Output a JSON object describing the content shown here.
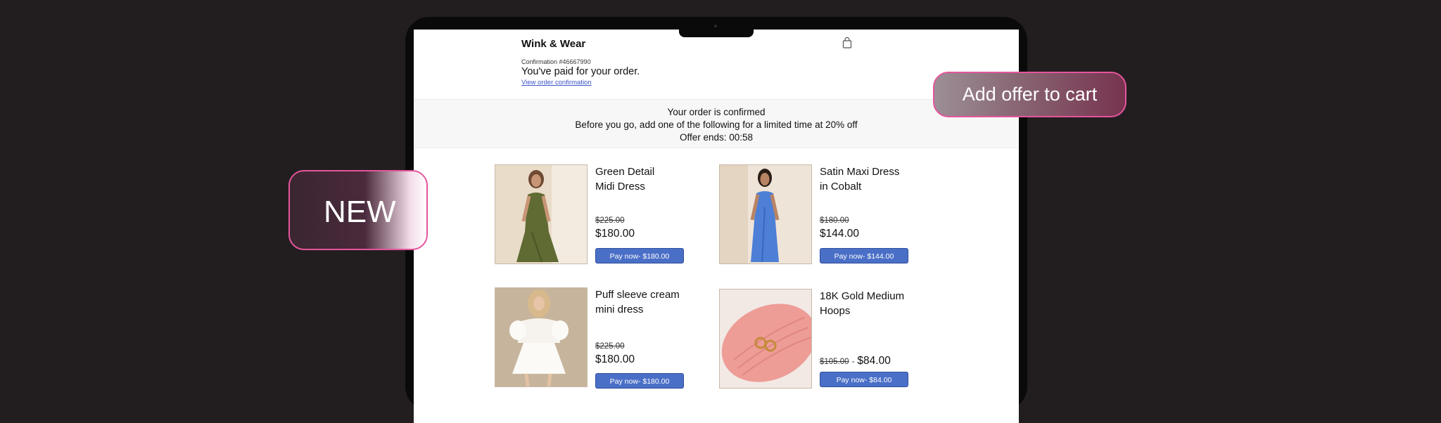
{
  "store": {
    "name": "Wink & Wear",
    "cart_icon": "shopping-bag-icon"
  },
  "confirmation": {
    "number": "Confirmation #46667990",
    "heading": "You've paid for your order.",
    "link": "View order confirmation"
  },
  "banner": {
    "line1": "Your order is confirmed",
    "line2": "Before you go, add one of the following for a limited time at 20% off",
    "line3": "Offer ends: 00:58"
  },
  "products": [
    {
      "name_line1": "Green Detail",
      "name_line2": "Midi Dress",
      "old_price": "$225.00",
      "new_price": "$180.00",
      "button": "Pay now- $180.00"
    },
    {
      "name_line1": "Satin Maxi Dress",
      "name_line2": "in Cobalt",
      "old_price": "$180.00",
      "new_price": "$144.00",
      "button": "Pay now- $144.00"
    },
    {
      "name_line1": "Puff sleeve cream",
      "name_line2": "mini dress",
      "old_price": "$225.00",
      "new_price": "$180.00",
      "button": "Pay now- $180.00"
    },
    {
      "name_line1": "18K Gold Medium",
      "name_line2": "Hoops",
      "old_price": "$105.00",
      "separator": "-",
      "new_price": "$84.00",
      "button": "Pay now- $84.00"
    }
  ],
  "callouts": {
    "new_label": "NEW",
    "cart_label": "Add offer to cart"
  },
  "colors": {
    "background": "#221e20",
    "button": "#4a6fc7",
    "callout_border": "#e5559c",
    "link": "#3a55c8"
  }
}
